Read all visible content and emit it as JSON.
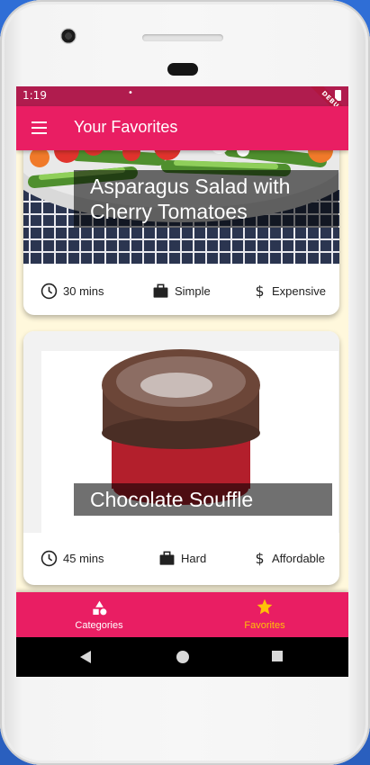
{
  "statusbar": {
    "time": "1:19",
    "dot": "•",
    "debug_banner": "DEBUG"
  },
  "appbar": {
    "title": "Your Favorites",
    "menu_icon": "menu-icon"
  },
  "meals": [
    {
      "title": "Asparagus Salad with Cherry Tomatoes",
      "duration": "30 mins",
      "complexity": "Simple",
      "affordability": "Expensive"
    },
    {
      "title": "Chocolate Souffle",
      "duration": "45 mins",
      "complexity": "Hard",
      "affordability": "Affordable"
    }
  ],
  "bottom_nav": {
    "items": [
      {
        "label": "Categories",
        "icon": "category-icon",
        "active": false
      },
      {
        "label": "Favorites",
        "icon": "star-icon",
        "active": true
      }
    ],
    "active_color": "#ffc107"
  },
  "colors": {
    "primary": "#e91e63",
    "status": "#b01c4e",
    "background": "#fff8dc",
    "accent": "#ffc107"
  }
}
